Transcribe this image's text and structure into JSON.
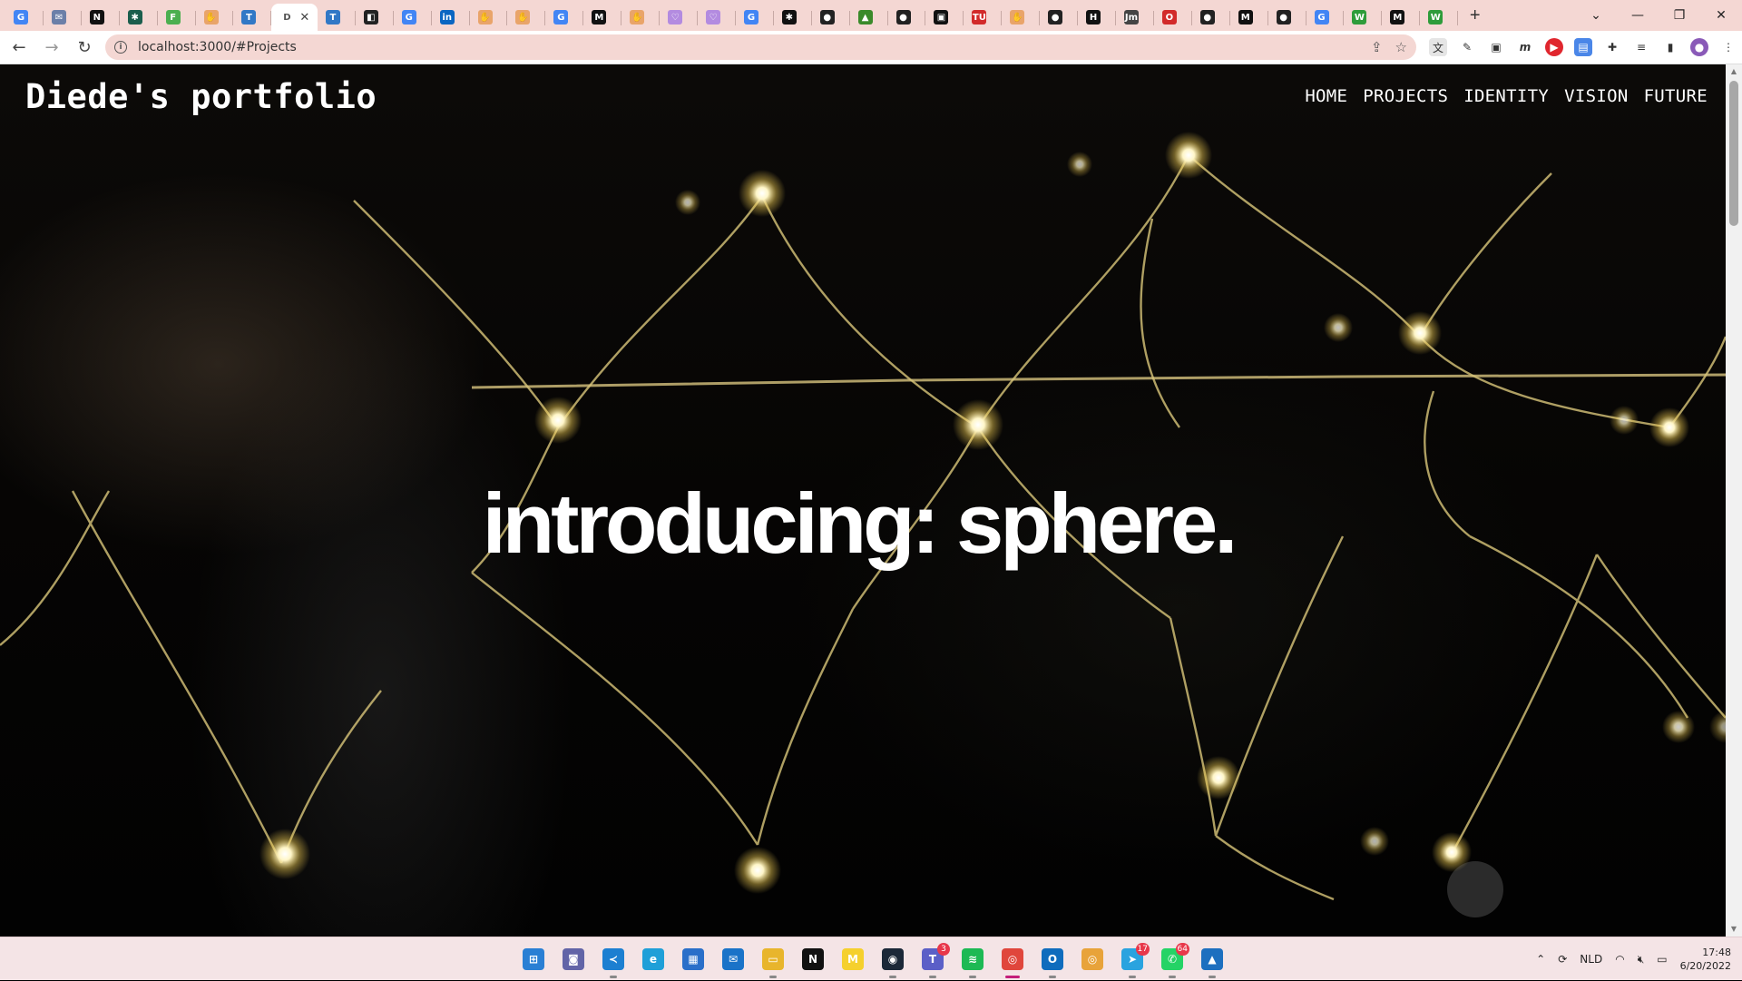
{
  "browser": {
    "tabs": [
      {
        "icon": "google-icon",
        "letter": "G",
        "color": "#4285f4"
      },
      {
        "icon": "mail-icon",
        "letter": "✉",
        "color": "#6b7fa8"
      },
      {
        "icon": "notion-icon",
        "letter": "N",
        "color": "#111111"
      },
      {
        "icon": "openai-icon",
        "letter": "✱",
        "color": "#1b5e4d"
      },
      {
        "icon": "frog-icon",
        "letter": "F",
        "color": "#4caf50"
      },
      {
        "icon": "hand-icon",
        "letter": "✋",
        "color": "#e9a46a"
      },
      {
        "icon": "trello-icon",
        "letter": "T",
        "color": "#3178c6"
      },
      {
        "icon": "current-page-icon",
        "letter": "D",
        "color": "#ffffff",
        "active": true
      },
      {
        "icon": "trello-icon",
        "letter": "T",
        "color": "#3178c6"
      },
      {
        "icon": "figma-icon",
        "letter": "◧",
        "color": "#222222"
      },
      {
        "icon": "google-icon",
        "letter": "G",
        "color": "#4285f4"
      },
      {
        "icon": "linkedin-icon",
        "letter": "in",
        "color": "#0a66c2"
      },
      {
        "icon": "hand-icon",
        "letter": "✋",
        "color": "#e9a46a"
      },
      {
        "icon": "hand-icon",
        "letter": "✋",
        "color": "#e9a46a"
      },
      {
        "icon": "google-icon",
        "letter": "G",
        "color": "#4285f4"
      },
      {
        "icon": "medium-icon",
        "letter": "M",
        "color": "#111111"
      },
      {
        "icon": "hand-icon",
        "letter": "✋",
        "color": "#e9a46a"
      },
      {
        "icon": "heart-icon",
        "letter": "♡",
        "color": "#b38be0"
      },
      {
        "icon": "heart-icon",
        "letter": "♡",
        "color": "#b38be0"
      },
      {
        "icon": "google-icon",
        "letter": "G",
        "color": "#4285f4"
      },
      {
        "icon": "openai-icon",
        "letter": "✱",
        "color": "#111111"
      },
      {
        "icon": "github-icon",
        "letter": "●",
        "color": "#222222"
      },
      {
        "icon": "turtle-icon",
        "letter": "▲",
        "color": "#3a8a2a"
      },
      {
        "icon": "github-icon",
        "letter": "●",
        "color": "#222222"
      },
      {
        "icon": "frame-icon",
        "letter": "▣",
        "color": "#111111"
      },
      {
        "icon": "tudelft-icon",
        "letter": "TU",
        "color": "#d22a2a"
      },
      {
        "icon": "hand-icon",
        "letter": "✋",
        "color": "#e9a46a"
      },
      {
        "icon": "github-icon",
        "letter": "●",
        "color": "#222222"
      },
      {
        "icon": "h-icon",
        "letter": "H",
        "color": "#111111"
      },
      {
        "icon": "jm-icon",
        "letter": "Jm",
        "color": "#444444"
      },
      {
        "icon": "opera-icon",
        "letter": "O",
        "color": "#d22a2a"
      },
      {
        "icon": "github-icon",
        "letter": "●",
        "color": "#222222"
      },
      {
        "icon": "medium-icon",
        "letter": "M",
        "color": "#111111"
      },
      {
        "icon": "github-icon",
        "letter": "●",
        "color": "#222222"
      },
      {
        "icon": "google-icon",
        "letter": "G",
        "color": "#4285f4"
      },
      {
        "icon": "w-icon",
        "letter": "W",
        "color": "#2e9c3a"
      },
      {
        "icon": "medium-icon",
        "letter": "M",
        "color": "#111111"
      },
      {
        "icon": "w-icon",
        "letter": "W",
        "color": "#2e9c3a"
      }
    ],
    "active_tab_letter": "D",
    "url": "localhost:3000/#Projects",
    "new_tab_label": "+"
  },
  "site": {
    "brand": "Diede's portfolio",
    "nav": [
      "HOME",
      "PROJECTS",
      "IDENTITY",
      "VISION",
      "FUTURE"
    ],
    "hero_title": "introducing: sphere."
  },
  "taskbar": {
    "apps": [
      {
        "icon": "windows-start-icon",
        "color": "#2a7fd4",
        "label": "⊞"
      },
      {
        "icon": "teams-chat-icon",
        "color": "#6264a7",
        "label": "◙"
      },
      {
        "icon": "vscode-icon",
        "color": "#1c7fd1",
        "label": "≺",
        "running": true
      },
      {
        "icon": "edge-icon",
        "color": "#1f9fd8",
        "label": "e"
      },
      {
        "icon": "store-icon",
        "color": "#2a6fc9",
        "label": "▦"
      },
      {
        "icon": "mail-icon",
        "color": "#1a73c8",
        "label": "✉"
      },
      {
        "icon": "file-explorer-icon",
        "color": "#e8b52c",
        "label": "▭",
        "running": true
      },
      {
        "icon": "notion-icon",
        "color": "#111111",
        "label": "N"
      },
      {
        "icon": "miro-icon",
        "color": "#f5d02d",
        "label": "M"
      },
      {
        "icon": "steam-icon",
        "color": "#1b2838",
        "label": "◉",
        "running": true
      },
      {
        "icon": "teams-icon",
        "color": "#5b5fc7",
        "label": "T",
        "badge": "3",
        "running": true
      },
      {
        "icon": "spotify-icon",
        "color": "#1db954",
        "label": "≋",
        "running": true
      },
      {
        "icon": "chrome-icon",
        "color": "#e0463c",
        "label": "◎",
        "active": true
      },
      {
        "icon": "outlook-icon",
        "color": "#0f6cbd",
        "label": "O",
        "running": true
      },
      {
        "icon": "chrome-profile-icon",
        "color": "#e8a33a",
        "label": "◎"
      },
      {
        "icon": "telegram-icon",
        "color": "#2aa3df",
        "label": "➤",
        "badge": "17",
        "running": true
      },
      {
        "icon": "whatsapp-icon",
        "color": "#25d366",
        "label": "✆",
        "badge": "64",
        "running": true
      },
      {
        "icon": "photos-icon",
        "color": "#1d6fbf",
        "label": "▲",
        "running": true
      }
    ],
    "tray": {
      "language": "NLD",
      "time": "17:48",
      "date": "6/20/2022"
    }
  }
}
